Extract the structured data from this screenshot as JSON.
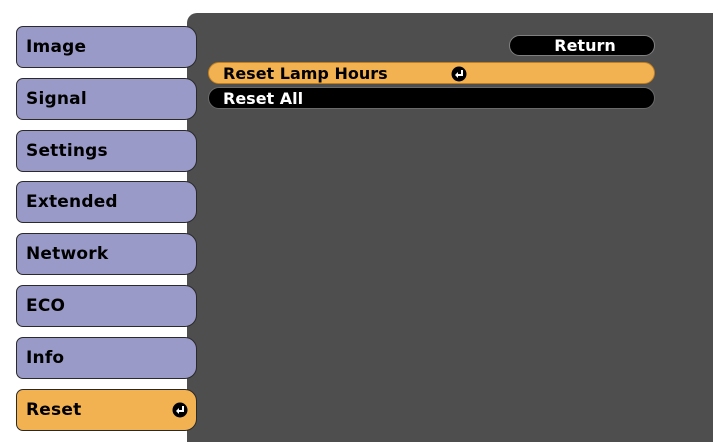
{
  "sidebar": {
    "items": [
      {
        "label": "Image",
        "active": false
      },
      {
        "label": "Signal",
        "active": false
      },
      {
        "label": "Settings",
        "active": false
      },
      {
        "label": "Extended",
        "active": false
      },
      {
        "label": "Network",
        "active": false
      },
      {
        "label": "ECO",
        "active": false
      },
      {
        "label": "Info",
        "active": false
      },
      {
        "label": "Reset",
        "active": true
      }
    ]
  },
  "main": {
    "return_label": "Return",
    "options": [
      {
        "label": "Reset Lamp Hours",
        "selected": true
      },
      {
        "label": "Reset All",
        "selected": false
      }
    ]
  },
  "colors": {
    "menu_item": "#9a9ac8",
    "highlight": "#f3b252",
    "panel": "#4e4e4f"
  },
  "icons": {
    "enter": "enter-icon"
  }
}
